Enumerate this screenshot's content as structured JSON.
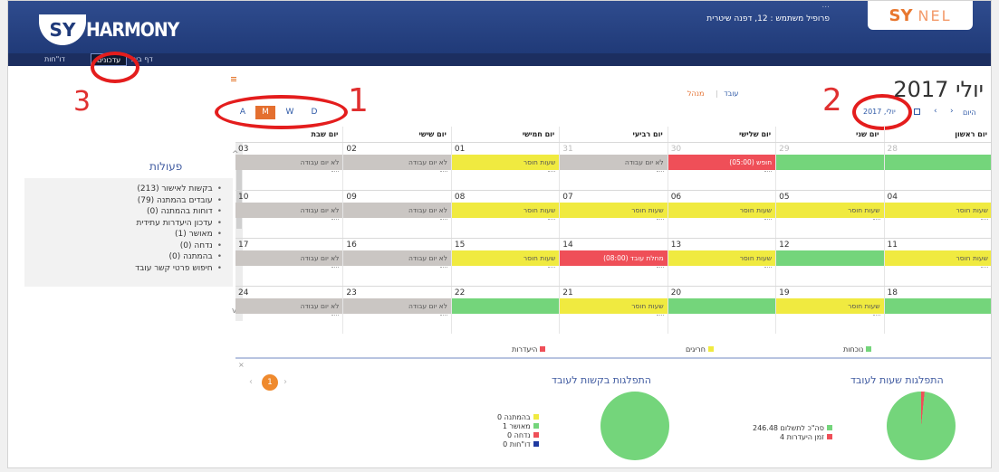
{
  "header": {
    "logo_sy": "SY",
    "logo_harmony": "HARMONY",
    "user_line1": "...",
    "user_line2": "פרופיל משתמש : 12, דפנה שיטרית",
    "brand": "SY",
    "brand_suffix": "NEL"
  },
  "nav": {
    "items": [
      "דף בית",
      "עדכונים",
      "דו\"חות"
    ],
    "active_index": 1
  },
  "annotations": [
    "1",
    "2",
    "3"
  ],
  "left_panel": {
    "title": "פעולות",
    "items": [
      "בקשות לאישור (213)",
      "עובדים בהמתנה (79)",
      "דוחות בהמתנה (0)",
      "עדכון היעדרות עתידית",
      "מאושר (1)",
      "נדחה (0)",
      "בהמתנה (0)",
      "חיפוש פרטי קשר עובד"
    ]
  },
  "toolbar": {
    "view_buttons": [
      "A",
      "M",
      "W",
      "D"
    ],
    "active_view": "M",
    "mode_selected": "עובד",
    "mode_other": "מנהל",
    "month_title": "יולי 2017",
    "today": "היום",
    "month_picker": "יולי, 2017",
    "prev": "‹",
    "next": "›"
  },
  "calendar": {
    "weekdays": [
      "יום שבת",
      "יום שישי",
      "יום חמישי",
      "יום רביעי",
      "יום שלישי",
      "יום שני",
      "יום ראשון"
    ],
    "weeks": [
      [
        {
          "day": "03",
          "event": "לא יום עבודה",
          "type": "grey"
        },
        {
          "day": "02",
          "event": "לא יום עבודה",
          "type": "grey"
        },
        {
          "day": "01",
          "event": "שעות חוסר",
          "type": "yellow"
        },
        {
          "day": "31",
          "event": "לא יום עבודה",
          "type": "grey",
          "muted": true
        },
        {
          "day": "30",
          "event": "חופש (05:00)",
          "type": "red",
          "muted": true
        },
        {
          "day": "29",
          "event": "",
          "type": "green",
          "muted": true
        },
        {
          "day": "28",
          "event": "",
          "type": "green",
          "muted": true
        }
      ],
      [
        {
          "day": "10",
          "event": "לא יום עבודה",
          "type": "grey"
        },
        {
          "day": "09",
          "event": "לא יום עבודה",
          "type": "grey"
        },
        {
          "day": "08",
          "event": "שעות חוסר",
          "type": "yellow"
        },
        {
          "day": "07",
          "event": "שעות חוסר",
          "type": "yellow"
        },
        {
          "day": "06",
          "event": "שעות חוסר",
          "type": "yellow"
        },
        {
          "day": "05",
          "event": "שעות חוסר",
          "type": "yellow"
        },
        {
          "day": "04",
          "event": "שעות חוסר",
          "type": "yellow"
        }
      ],
      [
        {
          "day": "17",
          "event": "לא יום עבודה",
          "type": "grey"
        },
        {
          "day": "16",
          "event": "לא יום עבודה",
          "type": "grey"
        },
        {
          "day": "15",
          "event": "שעות חוסר",
          "type": "yellow"
        },
        {
          "day": "14",
          "event": "מחלת עובד (08:00)",
          "type": "red"
        },
        {
          "day": "13",
          "event": "שעות חוסר",
          "type": "yellow"
        },
        {
          "day": "12",
          "event": "",
          "type": "green"
        },
        {
          "day": "11",
          "event": "שעות חוסר",
          "type": "yellow"
        }
      ],
      [
        {
          "day": "24",
          "event": "לא יום עבודה",
          "type": "grey"
        },
        {
          "day": "23",
          "event": "לא יום עבודה",
          "type": "grey"
        },
        {
          "day": "22",
          "event": "",
          "type": "green"
        },
        {
          "day": "21",
          "event": "שעות חוסר",
          "type": "yellow"
        },
        {
          "day": "20",
          "event": "",
          "type": "green"
        },
        {
          "day": "19",
          "event": "שעות חוסר",
          "type": "yellow"
        },
        {
          "day": "18",
          "event": "",
          "type": "green"
        }
      ]
    ]
  },
  "legend": [
    {
      "label": "היעדרות",
      "color": "#ef4f58"
    },
    {
      "label": "חריגים",
      "color": "#f0ea40"
    },
    {
      "label": "נוכחות",
      "color": "#74d57b"
    }
  ],
  "pager": {
    "page": "1",
    "prev": "‹",
    "next": "›"
  },
  "hours_panel": {
    "title": "התפלגות שעות לעובד",
    "items": [
      {
        "label": "סה\"כ לתשלום",
        "value": "246.48",
        "color": "#74d57b"
      },
      {
        "label": "זמן היעדרות",
        "value": "4",
        "color": "#ef4f58"
      }
    ],
    "pie_fraction_red": 0.016
  },
  "requests_panel": {
    "title": "התפלגות בקשות לעובד",
    "items": [
      {
        "label": "בהמתנה",
        "value": "0",
        "color": "#f0ea40"
      },
      {
        "label": "מאושר",
        "value": "1",
        "color": "#74d57b"
      },
      {
        "label": "נדחה",
        "value": "0",
        "color": "#ef4f58"
      },
      {
        "label": "דו\"חות",
        "value": "0",
        "color": "#1f3aa0"
      }
    ]
  },
  "colors": {
    "accent": "#e46f2f",
    "header_blue": "#2f4c8e",
    "link_blue": "#2d58a6",
    "annotation_red": "#e41d1d"
  }
}
